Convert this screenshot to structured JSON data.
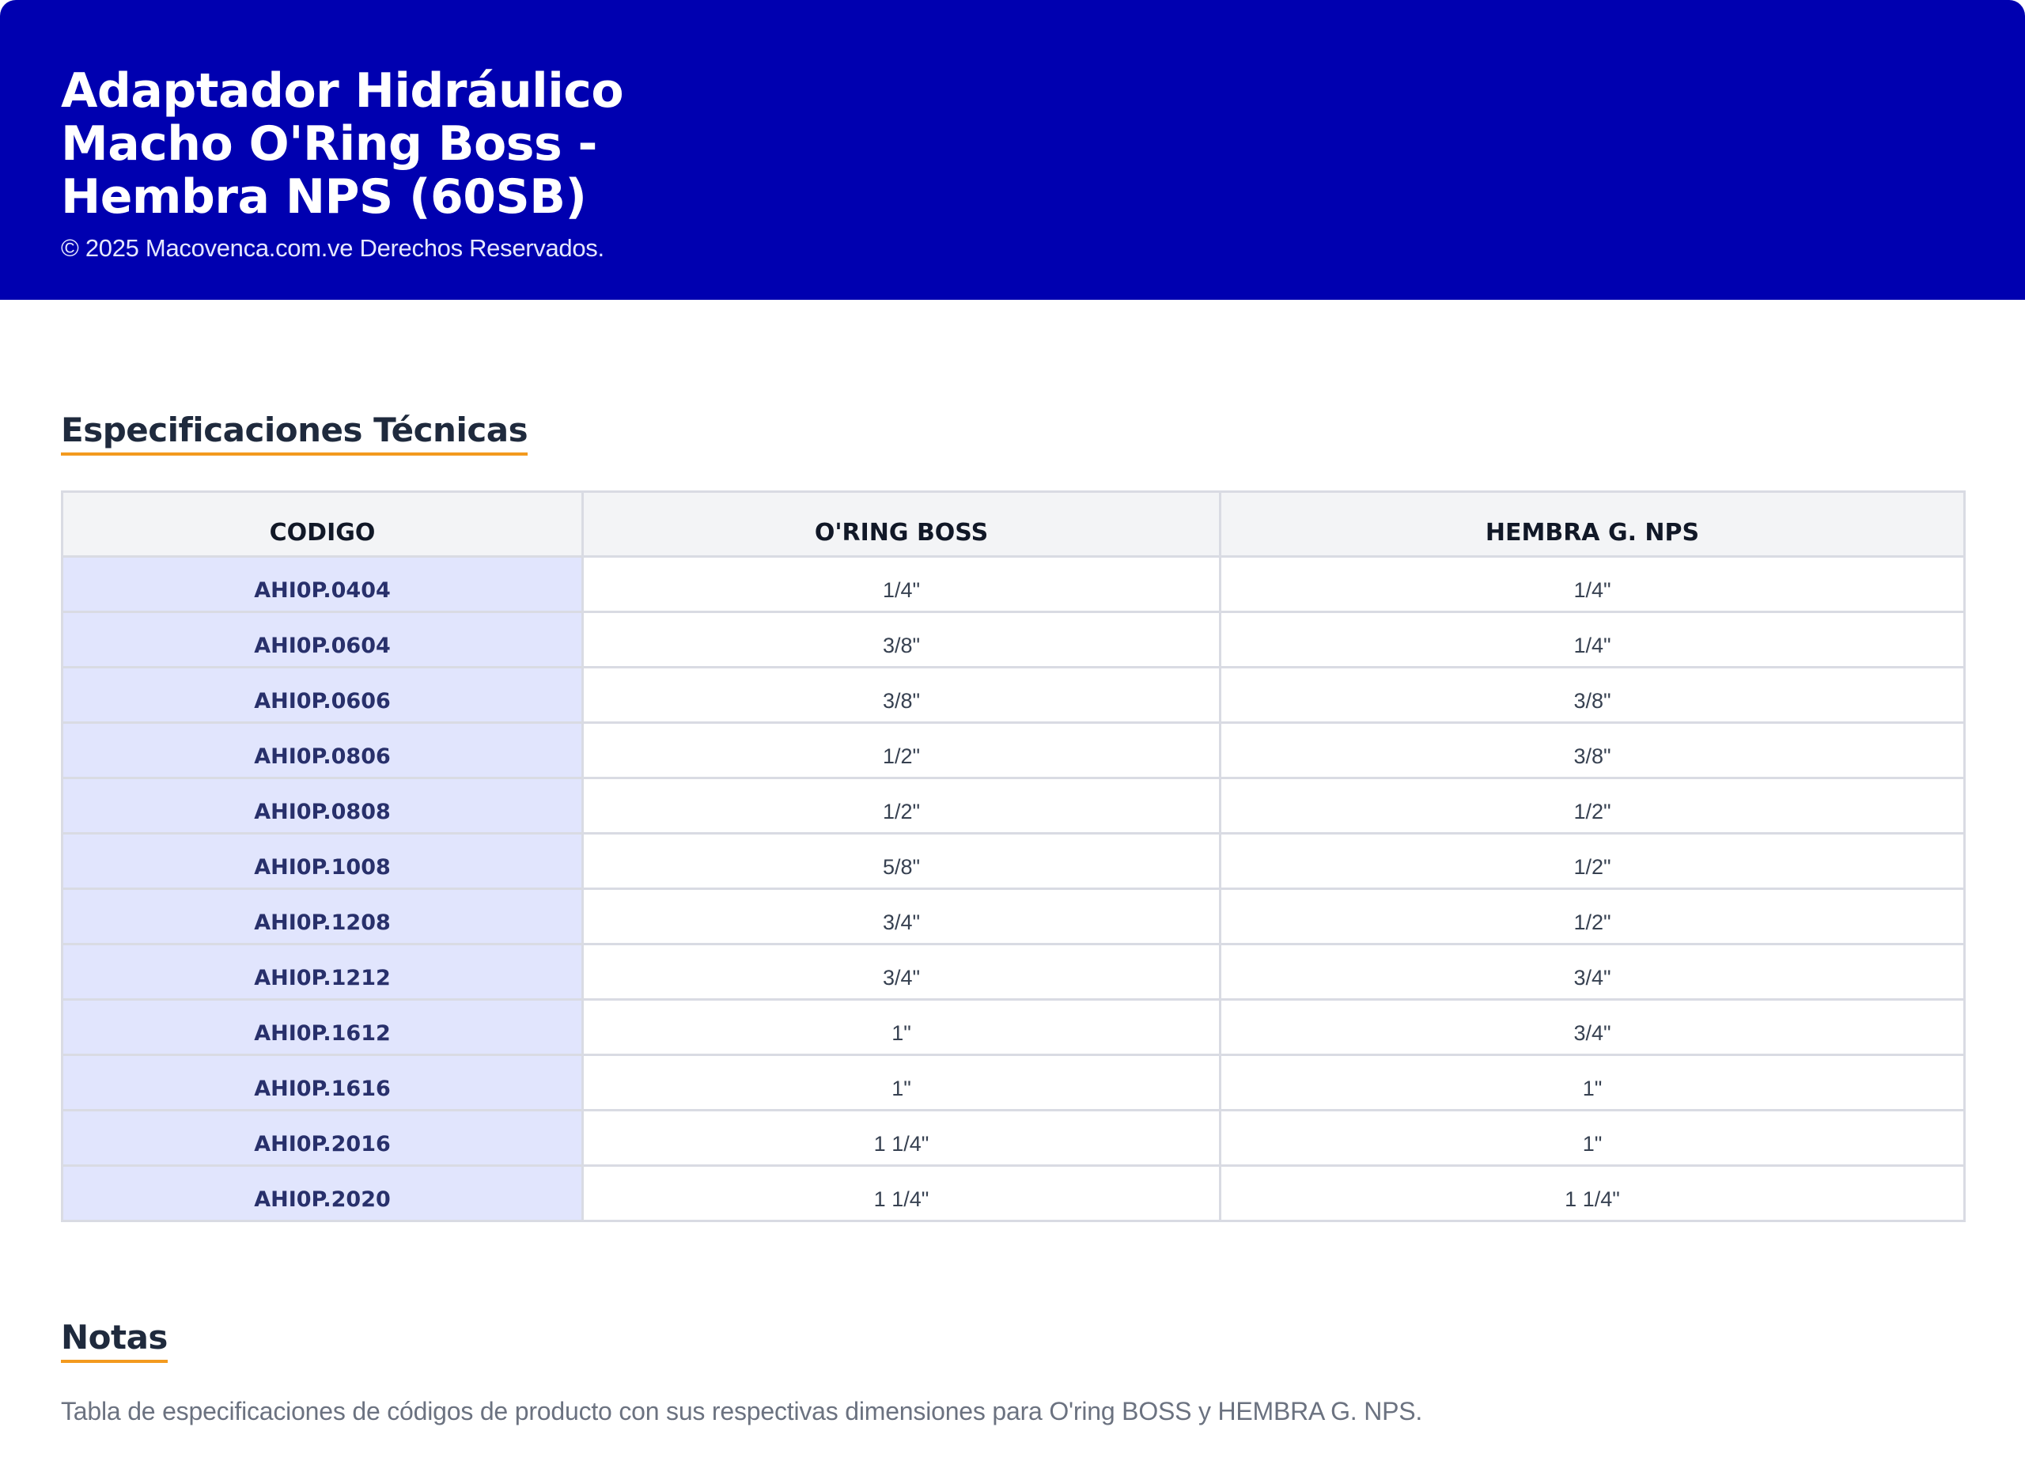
{
  "header": {
    "title": "Adaptador Hidráulico Macho O'Ring Boss - Hembra NPS (60SB)",
    "copyright": "© 2025 Macovenca.com.ve Derechos Reservados.",
    "background_color": "#0000b0"
  },
  "specs": {
    "title": "Especificaciones Técnicas",
    "columns": [
      "CODIGO",
      "O'RING BOSS",
      "HEMBRA G. NPS"
    ],
    "rows": [
      [
        "AHI0P.0404",
        "1/4\"",
        "1/4\""
      ],
      [
        "AHI0P.0604",
        "3/8\"",
        "1/4\""
      ],
      [
        "AHI0P.0606",
        "3/8\"",
        "3/8\""
      ],
      [
        "AHI0P.0806",
        "1/2\"",
        "3/8\""
      ],
      [
        "AHI0P.0808",
        "1/2\"",
        "1/2\""
      ],
      [
        "AHI0P.1008",
        "5/8\"",
        "1/2\""
      ],
      [
        "AHI0P.1208",
        "3/4\"",
        "1/2\""
      ],
      [
        "AHI0P.1212",
        "3/4\"",
        "3/4\""
      ],
      [
        "AHI0P.1612",
        "1\"",
        "3/4\""
      ],
      [
        "AHI0P.1616",
        "1\"",
        "1\""
      ],
      [
        "AHI0P.2016",
        "1 1/4\"",
        "1\""
      ],
      [
        "AHI0P.2020",
        "1 1/4\"",
        "1 1/4\""
      ]
    ],
    "code_cell_color": "#e1e5fd",
    "accent_underline_color": "#f39a1e"
  },
  "notes": {
    "title": "Notas",
    "text": "Tabla de especificaciones de códigos de producto con sus respectivas dimensiones para O'ring BOSS y HEMBRA G. NPS."
  }
}
